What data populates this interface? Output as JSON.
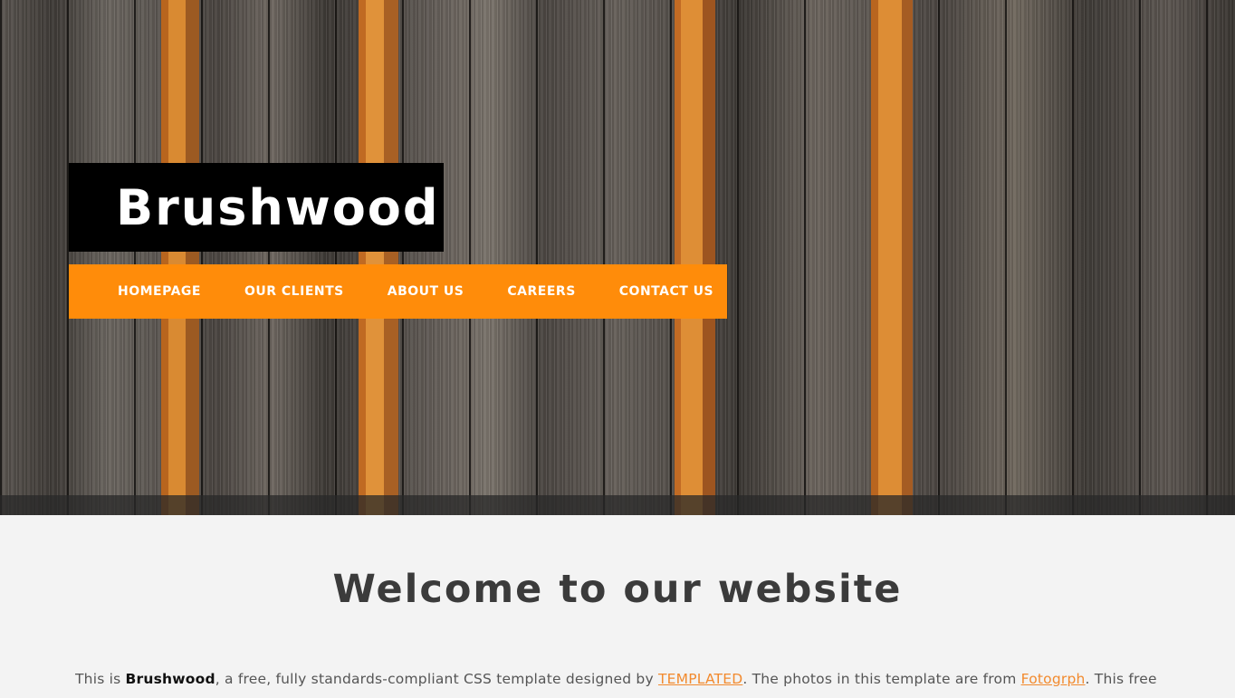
{
  "site": {
    "logo_text": "Brushwood"
  },
  "nav": {
    "items": [
      {
        "label": "HOMEPAGE"
      },
      {
        "label": "OUR CLIENTS"
      },
      {
        "label": "ABOUT US"
      },
      {
        "label": "CAREERS"
      },
      {
        "label": "CONTACT US"
      }
    ]
  },
  "main": {
    "heading": "Welcome to our website",
    "intro": {
      "part1": "This is ",
      "brand": "Brushwood",
      "part2": ", a free, fully standards-compliant CSS template designed by ",
      "link1": "TEMPLATED",
      "part3": ". The photos in this template are from ",
      "link2": "Fotogrph",
      "part4": ". This free"
    }
  },
  "colors": {
    "nav_background": "#ff8c0a",
    "logo_background": "#000000",
    "link": "#f28a2e",
    "page_background": "#f3f3f3"
  }
}
